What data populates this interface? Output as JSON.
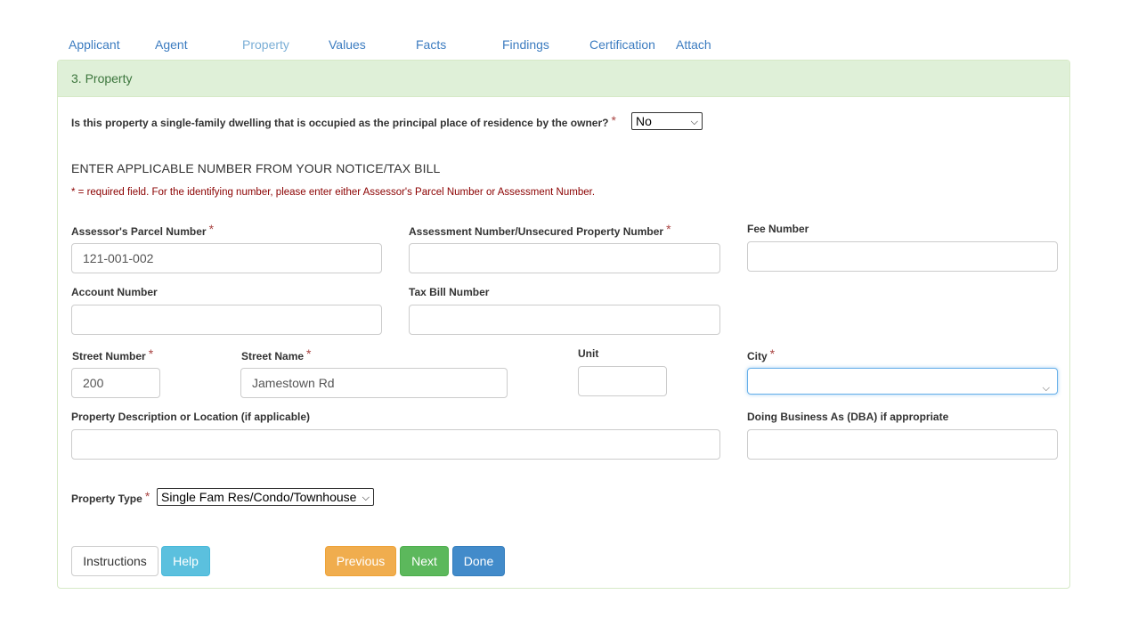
{
  "tabs": [
    {
      "label": "Applicant",
      "active": false
    },
    {
      "label": "Agent",
      "active": false
    },
    {
      "label": "Property",
      "active": true
    },
    {
      "label": "Values",
      "active": false
    },
    {
      "label": "Facts",
      "active": false
    },
    {
      "label": "Findings",
      "active": false
    },
    {
      "label": "Certification",
      "active": false
    },
    {
      "label": "Attach",
      "active": false
    }
  ],
  "panel": {
    "heading": "3. Property"
  },
  "question": {
    "text": "Is this property a single-family dwelling that is occupied as the principal place of residence by the owner?",
    "required_mark": "*",
    "selected": "No"
  },
  "section": {
    "title": "ENTER APPLICABLE NUMBER FROM YOUR NOTICE/TAX BILL",
    "note": "* = required field. For the identifying number, please enter either Assessor's Parcel Number or Assessment Number."
  },
  "fields": {
    "apn": {
      "label": "Assessor's Parcel Number",
      "required": "*",
      "value": "121-001-002"
    },
    "assessment": {
      "label": "Assessment Number/Unsecured Property Number",
      "required": "*",
      "value": ""
    },
    "fee": {
      "label": "Fee Number",
      "value": ""
    },
    "account": {
      "label": "Account Number",
      "value": ""
    },
    "taxbill": {
      "label": "Tax Bill Number",
      "value": ""
    },
    "street_number": {
      "label": "Street Number",
      "required": "*",
      "value": "200"
    },
    "street_name": {
      "label": "Street Name",
      "required": "*",
      "value": "Jamestown Rd"
    },
    "unit": {
      "label": "Unit",
      "value": ""
    },
    "city": {
      "label": "City",
      "required": "*",
      "value": ""
    },
    "description": {
      "label": "Property Description or Location (if applicable)",
      "value": ""
    },
    "dba": {
      "label": "Doing Business As (DBA) if appropriate",
      "value": ""
    },
    "property_type": {
      "label": "Property Type",
      "required": "*",
      "selected": "Single Fam Res/Condo/Townhouse"
    }
  },
  "buttons": {
    "instructions": "Instructions",
    "help": "Help",
    "previous": "Previous",
    "next": "Next",
    "done": "Done"
  },
  "colors": {
    "tab_link": "#3c7cc0",
    "tab_active": "#7aaed6",
    "panel_heading_bg": "#dff0d8",
    "panel_heading_text": "#3c763d",
    "required": "#a94442",
    "note": "#8b0000",
    "warning": "#f0ad4e",
    "success": "#5cb85c",
    "primary": "#428bca",
    "info": "#5bc0de"
  },
  "icons": {
    "select_arrow": "chevron-down-icon"
  }
}
